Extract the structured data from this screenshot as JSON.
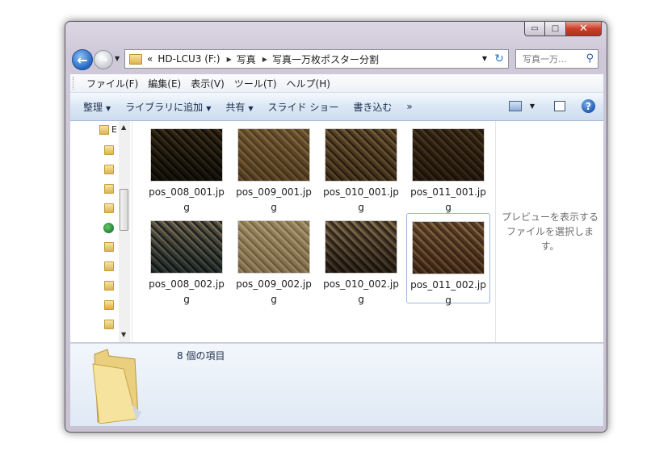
{
  "window": {
    "caption": {
      "minimize": "▭",
      "maximize": "□",
      "close": "✕"
    }
  },
  "nav": {
    "breadcrumb": [
      {
        "label": "«"
      },
      {
        "label": "HD-LCU3 (F:)"
      },
      {
        "label": "写真"
      },
      {
        "label": "写真一万枚ポスター分割"
      }
    ],
    "search_placeholder": "写真一万..."
  },
  "menubar": {
    "items": [
      "ファイル(F)",
      "編集(E)",
      "表示(V)",
      "ツール(T)",
      "ヘルプ(H)"
    ]
  },
  "toolbar": {
    "organize": "整理",
    "add_to_library": "ライブラリに追加",
    "share": "共有",
    "slideshow": "スライド ショー",
    "burn": "書き込む",
    "more": "»"
  },
  "navpane": {
    "first_item_letter": "E"
  },
  "files": [
    {
      "name": "pos_008_001.jpg",
      "colors": [
        "#2c2a20",
        "#6c5e42",
        "#a39476"
      ]
    },
    {
      "name": "pos_009_001.jpg",
      "colors": [
        "#8f7a5a",
        "#b5a27d",
        "#6e5c42"
      ]
    },
    {
      "name": "pos_010_001.jpg",
      "colors": [
        "#7d6a4e",
        "#a99775",
        "#3e3528"
      ]
    },
    {
      "name": "pos_011_001.jpg",
      "colors": [
        "#5a4a36",
        "#8a7758",
        "#3a3022"
      ]
    },
    {
      "name": "pos_008_002.jpg",
      "colors": [
        "#3b4a4c",
        "#9a8f7c",
        "#d8d2c4"
      ]
    },
    {
      "name": "pos_009_002.jpg",
      "colors": [
        "#b3a588",
        "#d2c6aa",
        "#8f8068"
      ]
    },
    {
      "name": "pos_010_002.jpg",
      "colors": [
        "#4a4036",
        "#b9ab90",
        "#7a6a54"
      ]
    },
    {
      "name": "pos_011_002.jpg",
      "colors": [
        "#7a6048",
        "#b8a183",
        "#5c4834"
      ]
    }
  ],
  "selected_file": "pos_011_002.jpg",
  "preview": {
    "text": "プレビューを表示するファイルを選択します。"
  },
  "details": {
    "count": "8 個の項目"
  },
  "colors": {
    "selection_border": "#9cb7d8",
    "toolbar_top": "#f5f9fd",
    "toolbar_bottom": "#cddcef",
    "close_red": "#c8402a"
  }
}
